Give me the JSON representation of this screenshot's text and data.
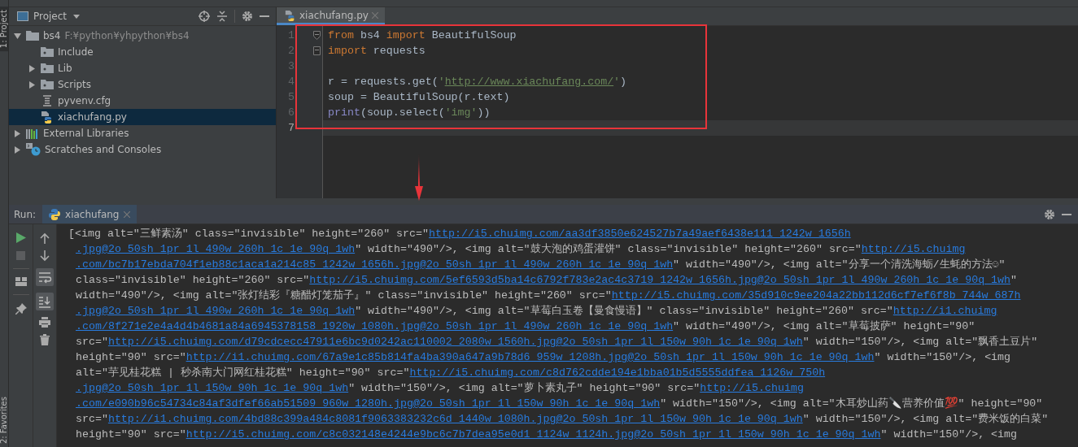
{
  "tool_stripe": {
    "top_label": "1: Project",
    "bottom_label": "2: Favorites"
  },
  "project_panel": {
    "title": "Project",
    "tree": [
      {
        "label": "bs4",
        "path": "F:¥python¥yhpython¥bs4",
        "kind": "folder",
        "expanded": true,
        "selected": false,
        "children": [
          {
            "label": "Include",
            "kind": "package",
            "selected": false
          },
          {
            "label": "Lib",
            "kind": "package",
            "expanded": false,
            "selected": false
          },
          {
            "label": "Scripts",
            "kind": "package",
            "expanded": false,
            "selected": false
          },
          {
            "label": "pyvenv.cfg",
            "kind": "config",
            "selected": false
          },
          {
            "label": "xiachufang.py",
            "kind": "python",
            "selected": true
          }
        ]
      },
      {
        "label": "External Libraries",
        "kind": "libraries",
        "expanded": false,
        "selected": false
      },
      {
        "label": "Scratches and Consoles",
        "kind": "scratches",
        "expanded": false,
        "selected": false
      }
    ]
  },
  "editor": {
    "tabs": [
      {
        "label": "xiachufang.py",
        "selected": true
      }
    ],
    "lines": [
      {
        "number": "1",
        "current": false,
        "tokens": [
          {
            "text": "from ",
            "kind": "keyword"
          },
          {
            "text": "bs4 ",
            "kind": "plain"
          },
          {
            "text": "import ",
            "kind": "keyword"
          },
          {
            "text": "BeautifulSoup",
            "kind": "plain"
          }
        ]
      },
      {
        "number": "2",
        "current": false,
        "tokens": [
          {
            "text": "import ",
            "kind": "keyword"
          },
          {
            "text": "requests",
            "kind": "plain"
          }
        ]
      },
      {
        "number": "3",
        "current": false
      },
      {
        "number": "4",
        "current": false,
        "tokens": [
          {
            "text": "r = requests.get(",
            "kind": "plain"
          },
          {
            "text": "'",
            "kind": "string"
          },
          {
            "text": "http://www.xiachufang.com/",
            "kind": "link"
          },
          {
            "text": "'",
            "kind": "string"
          },
          {
            "text": ")",
            "kind": "plain"
          }
        ]
      },
      {
        "number": "5",
        "current": false,
        "tokens": [
          {
            "text": "soup = BeautifulSoup(r.text)",
            "kind": "plain"
          }
        ]
      },
      {
        "number": "6",
        "current": false,
        "tokens": [
          {
            "text": "print",
            "kind": "builtin"
          },
          {
            "text": "(soup.select(",
            "kind": "plain"
          },
          {
            "text": "'img'",
            "kind": "string"
          },
          {
            "text": "))",
            "kind": "plain"
          }
        ]
      },
      {
        "number": "7",
        "current": true
      }
    ]
  },
  "run_panel": {
    "label": "Run:",
    "tabs": [
      {
        "label": "xiachufang",
        "selected": true
      }
    ],
    "output": [
      [
        {
          "text": "[<img alt=\"三鲜素汤\" class=\"invisible\" height=\"260\" src=\"",
          "link": false
        },
        {
          "text": "http://i5.chuimg.com/aa3df3850e624527b7a49aef6438e111_1242w_1656h",
          "link": true
        }
      ],
      [
        {
          "text": ".jpg@2o_50sh_1pr_1l_490w_260h_1c_1e_90q_1wh",
          "link": true
        },
        {
          "text": "\" width=\"490\"/>, <img alt=\"鼓大泡的鸡蛋灌饼\" class=\"invisible\" height=\"260\" src=\"",
          "link": false
        },
        {
          "text": "http://i5.chuimg",
          "link": true
        }
      ],
      [
        {
          "text": ".com/bc7b17ebda704f1eb88c1aca1a214c85_1242w_1656h.jpg@2o_50sh_1pr_1l_490w_260h_1c_1e_90q_1wh",
          "link": true
        },
        {
          "text": "\" width=\"490\"/>, <img alt=\"分享一个清洗海蛎/生蚝的方法☺\"",
          "link": false
        }
      ],
      [
        {
          "text": "class=\"invisible\" height=\"260\" src=\"",
          "link": false
        },
        {
          "text": "http://i5.chuimg.com/5ef6593d5ba14c6792f783e2ac4c3719_1242w_1656h.jpg@2o_50sh_1pr_1l_490w_260h_1c_1e_90q_1wh",
          "link": true
        },
        {
          "text": "\"",
          "link": false
        }
      ],
      [
        {
          "text": "width=\"490\"/>, <img alt=\"张灯结彩『糖醋灯笼茄子』\" class=\"invisible\" height=\"260\" src=\"",
          "link": false
        },
        {
          "text": "http://i5.chuimg.com/35d910c9ee204a22bb112d6cf7ef6f8b_744w_687h",
          "link": true
        }
      ],
      [
        {
          "text": ".jpg@2o_50sh_1pr_1l_490w_260h_1c_1e_90q_1wh",
          "link": true
        },
        {
          "text": "\" width=\"490\"/>, <img alt=\"草莓白玉卷【曼食慢语】\" class=\"invisible\" height=\"260\" src=\"",
          "link": false
        },
        {
          "text": "http://i1.chuimg",
          "link": true
        }
      ],
      [
        {
          "text": ".com/8f271e2e4a4d4b4681a84a6945378158_1920w_1080h.jpg@2o_50sh_1pr_1l_490w_260h_1c_1e_90q_1wh",
          "link": true
        },
        {
          "text": "\" width=\"490\"/>, <img alt=\"草莓披萨\" height=\"90\"",
          "link": false
        }
      ],
      [
        {
          "text": "src=\"",
          "link": false
        },
        {
          "text": "http://i5.chuimg.com/d79cdcecc47911e6bc9d0242ac110002_2080w_1560h.jpg@2o_50sh_1pr_1l_150w_90h_1c_1e_90q_1wh",
          "link": true
        },
        {
          "text": "\" width=\"150\"/>, <img alt=\"飘香土豆片\"",
          "link": false
        }
      ],
      [
        {
          "text": "height=\"90\" src=\"",
          "link": false
        },
        {
          "text": "http://i1.chuimg.com/67a9e1c85b814fa4ba390a647a9b78d6_959w_1208h.jpg@2o_50sh_1pr_1l_150w_90h_1c_1e_90q_1wh",
          "link": true
        },
        {
          "text": "\" width=\"150\"/>, <img",
          "link": false
        }
      ],
      [
        {
          "text": "alt=\"芋见桂花糕 | 秒杀南大门网红桂花糕\" height=\"90\" src=\"",
          "link": false
        },
        {
          "text": "http://i5.chuimg.com/c8d762cdde194e1bba01b5d5555ddfea_1126w_750h",
          "link": true
        }
      ],
      [
        {
          "text": ".jpg@2o_50sh_1pr_1l_150w_90h_1c_1e_90q_1wh",
          "link": true
        },
        {
          "text": "\" width=\"150\"/>, <img alt=\"萝卜素丸子\" height=\"90\" src=\"",
          "link": false
        },
        {
          "text": "http://i5.chuimg",
          "link": true
        }
      ],
      [
        {
          "text": ".com/e090b96c54734c84af3dfef66ab51509_960w_1280h.jpg@2o_50sh_1pr_1l_150w_90h_1c_1e_90q_1wh",
          "link": true
        },
        {
          "text": "\" width=\"150\"/>, <img alt=\"木耳炒山药🔪营养价值💯\" height=\"90\"",
          "link": false
        }
      ],
      [
        {
          "text": "src=\"",
          "link": false
        },
        {
          "text": "http://i1.chuimg.com/4bd88c399a484c8081f9063383232c6d_1440w_1080h.jpg@2o_50sh_1pr_1l_150w_90h_1c_1e_90q_1wh",
          "link": true
        },
        {
          "text": "\" width=\"150\"/>, <img alt=\"费米饭的白菜\"",
          "link": false
        }
      ],
      [
        {
          "text": "height=\"90\" src=\"",
          "link": false
        },
        {
          "text": "http://i5.chuimg.com/c8c032148e4244e9bc6c7b7dea95e0d1_1124w_1124h.jpg@2o_50sh_1pr_1l_150w_90h_1c_1e_90q_1wh",
          "link": true
        },
        {
          "text": "\" width=\"150\"/>, <img",
          "link": false
        }
      ]
    ]
  }
}
